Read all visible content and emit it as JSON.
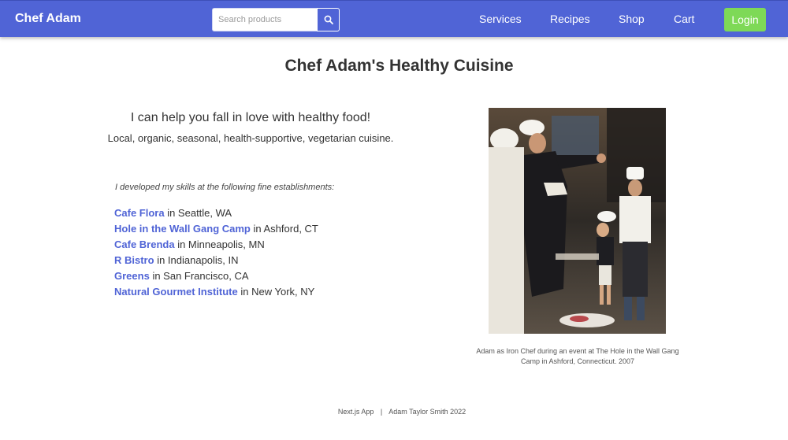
{
  "nav": {
    "brand": "Chef Adam",
    "search_placeholder": "Search products",
    "links": [
      "Services",
      "Recipes",
      "Shop",
      "Cart"
    ],
    "login_label": "Login",
    "colors": {
      "bar": "#5064d6",
      "login": "#7ed957"
    }
  },
  "main": {
    "title": "Chef Adam's Healthy Cuisine",
    "tagline": "I can help you fall in love with healthy food!",
    "subtagline": "Local, organic, seasonal, health-supportive, vegetarian cuisine.",
    "skills_intro": "I developed my skills at the following fine establishments:",
    "establishments": [
      {
        "name": "Cafe Flora",
        "location": "in Seattle, WA"
      },
      {
        "name": "Hole in the Wall Gang Camp",
        "location": "in Ashford, CT"
      },
      {
        "name": "Cafe Brenda",
        "location": "in Minneapolis, MN"
      },
      {
        "name": "R Bistro",
        "location": "in Indianapolis, IN"
      },
      {
        "name": "Greens",
        "location": "in San Francisco, CA"
      },
      {
        "name": "Natural Gourmet Institute",
        "location": "in New York, NY"
      }
    ],
    "photo_caption": "Adam as Iron Chef during an event at The Hole in the Wall Gang Camp in Ashford, Connecticut. 2007"
  },
  "footer": {
    "left": "Next.js App",
    "separator": "|",
    "right": "Adam Taylor Smith 2022"
  },
  "icons": {
    "search": "magnifier-icon"
  }
}
